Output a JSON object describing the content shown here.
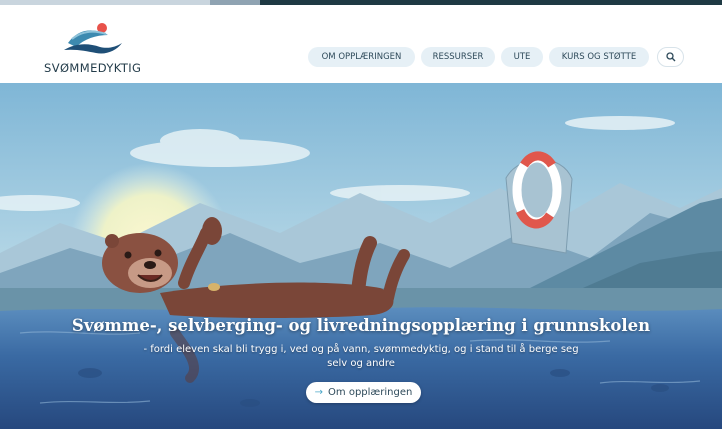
{
  "brand": {
    "name": "SVØMMEDYKTIG"
  },
  "nav": {
    "items": [
      {
        "label": "OM OPPLÆRINGEN"
      },
      {
        "label": "RESSURSER"
      },
      {
        "label": "UTE"
      },
      {
        "label": "KURS OG STØTTE"
      }
    ],
    "search_icon": "search-icon"
  },
  "hero": {
    "title": "Svømme-, selvberging- og livredningsopplæring i grunnskolen",
    "subtitle": "- fordi eleven skal bli trygg i, ved og på vann, svømmedyktig, og i stand til å berge seg selv og andre",
    "cta_label": "Om opplæringen",
    "cta_icon": "arrow-right-icon"
  },
  "colors": {
    "accent": "#4fa9c9",
    "nav_pill": "#e6f0f6",
    "water": "#2f5e96",
    "sky": "#bfdde9",
    "logo_sun": "#e8524a"
  }
}
